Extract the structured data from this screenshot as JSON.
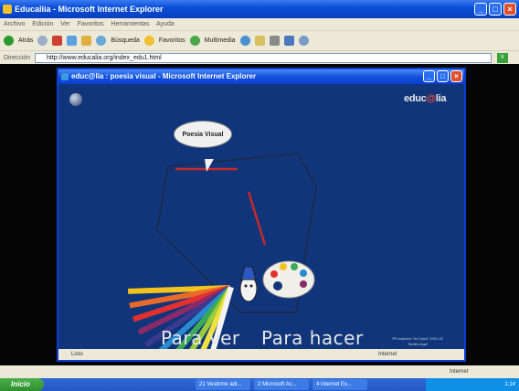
{
  "outer_window": {
    "title": "Educaliia - Microsoft Internet Explorer",
    "menu": [
      "Archivo",
      "Edición",
      "Ver",
      "Favoritos",
      "Herramientas",
      "Ayuda"
    ],
    "toolbar": {
      "back": "Atrás",
      "search": "Búsqueda",
      "favorites": "Favoritos",
      "multimedia": "Multimedia"
    },
    "address_label": "Dirección",
    "address": "http://www.educalia.org/index_edu1.html",
    "go_label": "Ir",
    "status_right": "Internet"
  },
  "popup_window": {
    "title": "educ@lia : poesia visual - Microsoft Internet Explorer",
    "status_left": "Listo",
    "status_right": "Internet"
  },
  "stage": {
    "logo_text": "educ",
    "logo_at": "@",
    "logo_rest": "lia",
    "bubble": "Poesia Visual",
    "button_ver": "Para ver",
    "button_hacer": "Para hacer",
    "credit": "©Fundación \"la Caixa\" 2001-02 Tantes legal"
  },
  "taskbar": {
    "start": "Inicio",
    "items": [
      "21 Vestirme adi...",
      "2 Microsoft Ac...",
      "4 Internet Ex..."
    ],
    "clock": "1:14"
  },
  "colors": {
    "stage_bg": "#10357a",
    "xp_blue": "#0b3ed1",
    "start_green": "#2e8e2e"
  }
}
